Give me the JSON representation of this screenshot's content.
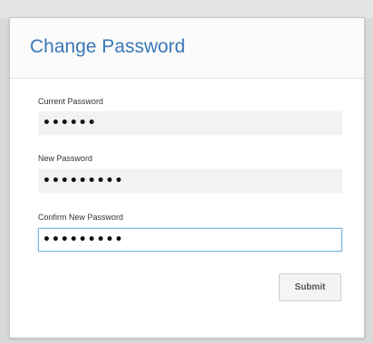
{
  "dialog": {
    "title": "Change Password",
    "fields": [
      {
        "label": "Current Password",
        "value": "••••••"
      },
      {
        "label": "New Password",
        "value": "•••••••••"
      },
      {
        "label": "Confirm New Password",
        "value": "•••••••••"
      }
    ],
    "submit_label": "Submit"
  },
  "colors": {
    "title": "#3a78b8",
    "focus_border": "#7db7de",
    "input_background": "#f2f2f2"
  }
}
